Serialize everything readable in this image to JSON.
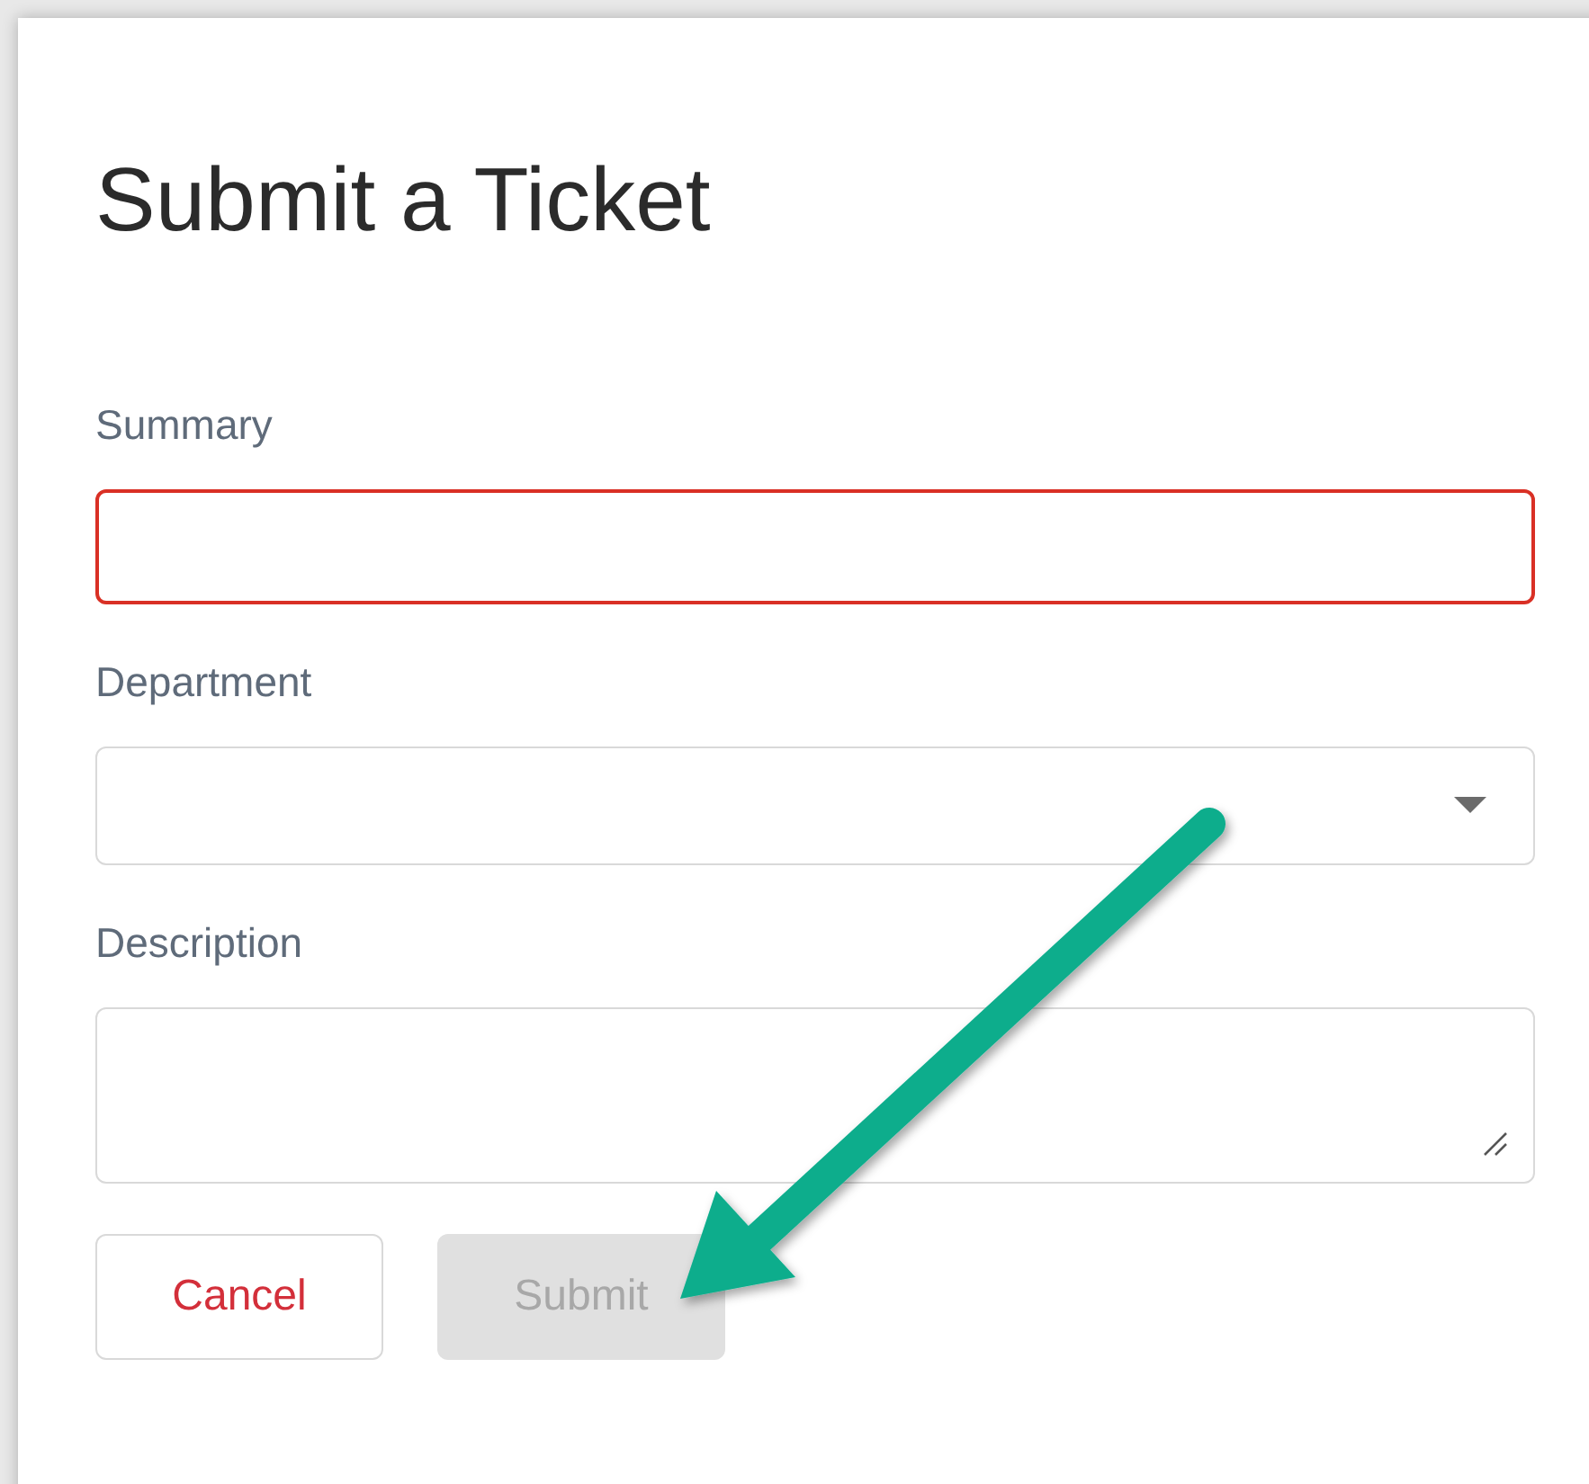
{
  "dialog": {
    "title": "Submit a Ticket"
  },
  "fields": [
    {
      "kind": "text",
      "label": "Summary",
      "error": true
    },
    {
      "kind": "select",
      "label": "Department",
      "error": false
    },
    {
      "kind": "textarea",
      "label": "Description",
      "error": false
    }
  ],
  "buttons": [
    {
      "kind": "cancel",
      "label": "Cancel",
      "disabled": false
    },
    {
      "kind": "submit",
      "label": "Submit",
      "disabled": true
    }
  ]
}
